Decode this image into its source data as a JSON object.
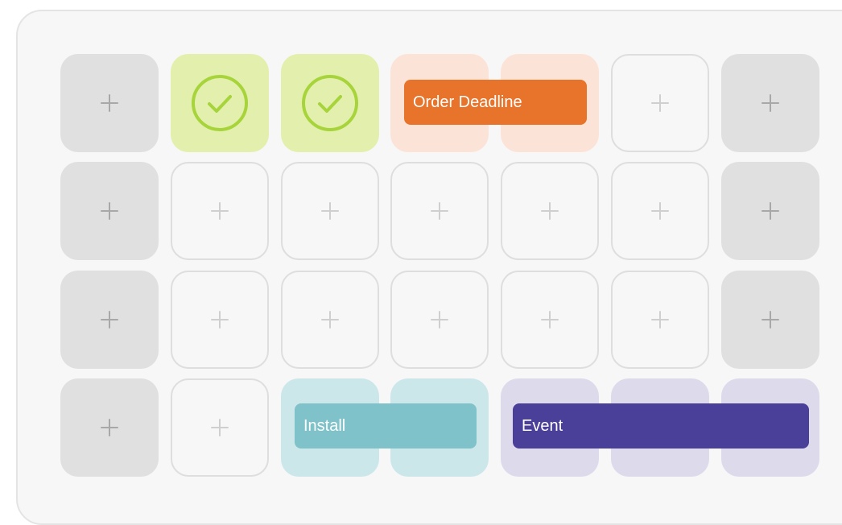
{
  "calendar": {
    "bars": {
      "order_deadline": "Order Deadline",
      "install": "Install",
      "event": "Event"
    },
    "cell_types": [
      [
        "weekend",
        "done",
        "done",
        "order",
        "order",
        "empty",
        "weekend"
      ],
      [
        "weekend",
        "empty",
        "empty",
        "empty",
        "empty",
        "empty",
        "weekend"
      ],
      [
        "weekend",
        "empty",
        "empty",
        "empty",
        "empty",
        "empty",
        "weekend"
      ],
      [
        "weekend",
        "empty",
        "install",
        "install",
        "event",
        "event",
        "event"
      ]
    ],
    "colors": {
      "done": "#e3f0ad",
      "check": "#a6d43a",
      "order_light": "#fce3d7",
      "order": "#e8732a",
      "install_light": "#cbe7ea",
      "install": "#7fc2c9",
      "event_light": "#dddbeb",
      "event": "#4a3f99",
      "weekend": "#e0e0e0"
    },
    "icons": {
      "add": "plus-icon",
      "completed": "check-circle-icon"
    }
  }
}
